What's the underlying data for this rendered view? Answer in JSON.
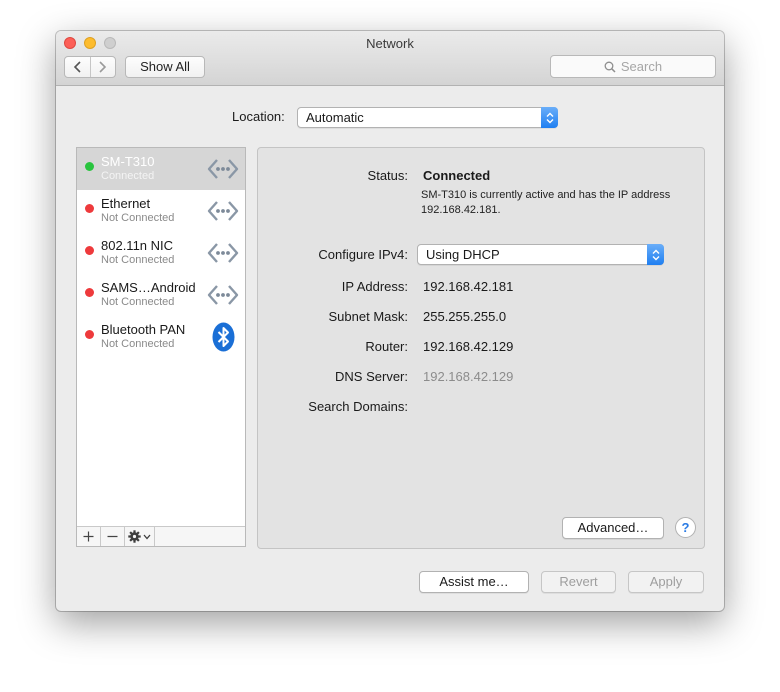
{
  "window": {
    "title": "Network"
  },
  "toolbar": {
    "show_all_label": "Show All",
    "search_placeholder": "Search"
  },
  "location": {
    "label": "Location:",
    "value": "Automatic"
  },
  "services": [
    {
      "name": "SM-T310",
      "status": "Connected",
      "state": "connected",
      "icon": "ethernet-arrows-icon",
      "selected": true
    },
    {
      "name": "Ethernet",
      "status": "Not Connected",
      "state": "disconnected",
      "icon": "ethernet-arrows-icon"
    },
    {
      "name": "802.11n NIC",
      "status": "Not Connected",
      "state": "disconnected",
      "icon": "ethernet-arrows-icon"
    },
    {
      "name": "SAMS…Android",
      "status": "Not Connected",
      "state": "disconnected",
      "icon": "ethernet-arrows-icon"
    },
    {
      "name": "Bluetooth PAN",
      "status": "Not Connected",
      "state": "disconnected",
      "icon": "bluetooth-icon"
    }
  ],
  "sidebar_toolbar": {
    "add": "+",
    "remove": "—"
  },
  "detail": {
    "status_label": "Status:",
    "status_value": "Connected",
    "status_desc": "SM-T310 is currently active and has the IP address 192.168.42.181.",
    "configure_label": "Configure IPv4:",
    "configure_value": "Using DHCP",
    "ip_label": "IP Address:",
    "ip_value": "192.168.42.181",
    "subnet_label": "Subnet Mask:",
    "subnet_value": "255.255.255.0",
    "router_label": "Router:",
    "router_value": "192.168.42.129",
    "dns_label": "DNS Server:",
    "dns_value": "192.168.42.129",
    "search_domains_label": "Search Domains:",
    "advanced_label": "Advanced…",
    "help_label": "?"
  },
  "footer": {
    "assist_label": "Assist me…",
    "revert_label": "Revert",
    "apply_label": "Apply"
  },
  "colors": {
    "connected": "#29c43e",
    "disconnected": "#ee3a3c",
    "accent": "#1f7ff1",
    "selection": "#d6d6d6"
  }
}
